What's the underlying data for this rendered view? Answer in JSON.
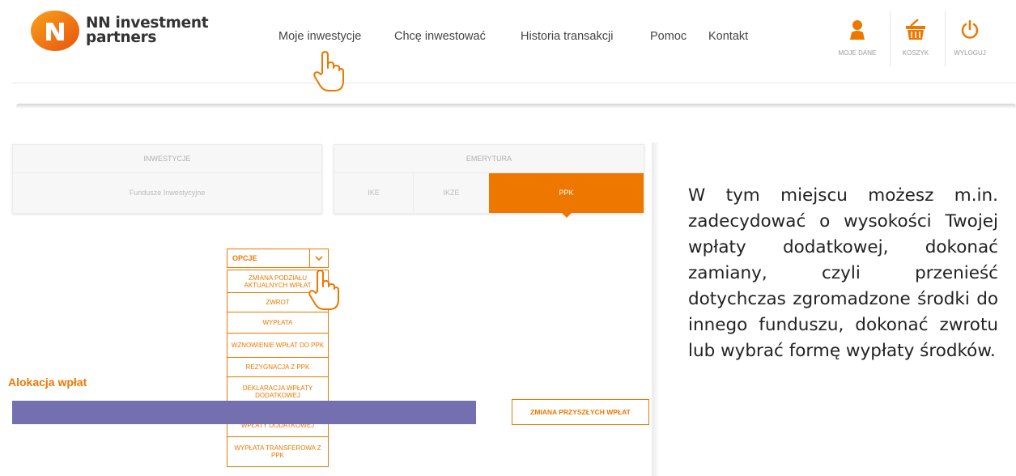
{
  "brand": {
    "line1": "NN investment",
    "line2": "partners",
    "accent": "#ee7700"
  },
  "nav": [
    {
      "label": "Moje inwestycje"
    },
    {
      "label": "Chcę inwestować"
    },
    {
      "label": "Historia transakcji"
    },
    {
      "label": "Pomoc"
    },
    {
      "label": "Kontakt"
    }
  ],
  "utility": {
    "profile": {
      "label": "MOJE DANE",
      "icon": "user-icon"
    },
    "cart": {
      "label": "KOSZYK",
      "icon": "basket-icon"
    },
    "logout": {
      "label": "WYLOGUJ",
      "icon": "power-icon"
    }
  },
  "tabs": {
    "investments": {
      "header": "INWESTYCJE",
      "items": [
        "Fundusze Inwestycyjne"
      ]
    },
    "retirement": {
      "header": "EMERYTURA",
      "items": [
        "IKE",
        "IKZE",
        "PPK"
      ],
      "active": "PPK"
    }
  },
  "options": {
    "label": "OPCJE",
    "items": [
      "ZMIANA PODZIAŁU AKTUALNYCH WPŁAT",
      "ZWROT",
      "WYPŁATA",
      "WZNOWIENIE WPŁAT DO PPK",
      "REZYGNACJA Z PPK",
      "DEKLARACJA WPŁATY DODATKOWEJ",
      "ZMIANA / REZYGNACJA Z WPŁATY DODATKOWEJ",
      "WYPŁATA TRANSFEROWA Z PPK"
    ]
  },
  "section": {
    "title": "Alokacja wpłat"
  },
  "buttons": {
    "future_change": "ZMIANA PRZYSZŁYCH WPŁAT"
  },
  "colors": {
    "accent": "#ee7700",
    "bar": "#7470b0"
  },
  "description": "W tym miejscu możesz m.in. zadecydować o wysokości Twojej wpłaty dodatkowej, dokonać zamiany, czyli przenieść dotychczas zgromadzone środki do innego funduszu, dokonać zwrotu lub wybrać formę wypłaty środków."
}
